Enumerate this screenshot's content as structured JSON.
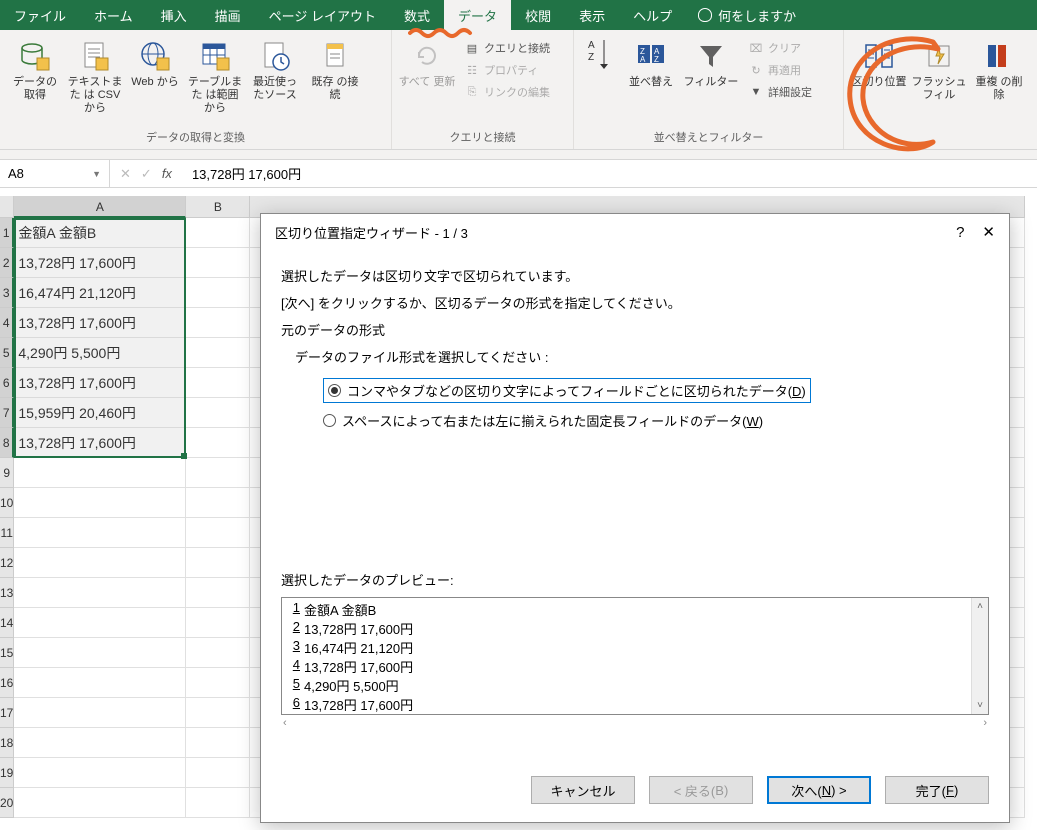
{
  "tabs": {
    "file": "ファイル",
    "home": "ホーム",
    "insert": "挿入",
    "draw": "描画",
    "pagelayout": "ページ レイアウト",
    "formulas": "数式",
    "data": "データ",
    "review": "校閲",
    "view": "表示",
    "help": "ヘルプ",
    "tellme": "何をしますか"
  },
  "ribbon": {
    "group_get": "データの取得と変換",
    "group_queries": "クエリと接続",
    "group_sort": "並べ替えとフィルター",
    "btn_getdata": "データの\n取得",
    "btn_textcsv": "テキストまた\nは CSV から",
    "btn_web": "Web\nから",
    "btn_tablerange": "テーブルまた\nは範囲から",
    "btn_recent": "最近使っ\nたソース",
    "btn_existing": "既存\nの接続",
    "btn_refresh": "すべて\n更新",
    "mini_queries": "クエリと接続",
    "mini_props": "プロパティ",
    "mini_editlinks": "リンクの編集",
    "btn_sort": "並べ替え",
    "btn_filter": "フィルター",
    "mini_clear": "クリア",
    "mini_reapply": "再適用",
    "mini_advanced": "詳細設定",
    "btn_texttocol": "区切り位置",
    "btn_flashfill": "フラッシュ\nフィル",
    "btn_removedup": "重複\nの削除"
  },
  "formula_bar": {
    "name": "A8",
    "value": "13,728円 17,600円"
  },
  "grid": {
    "col_a": "A",
    "col_b": "B",
    "rows": [
      "金額A 金額B",
      "13,728円 17,600円",
      "16,474円 21,120円",
      "13,728円 17,600円",
      "4,290円 5,500円",
      "13,728円 17,600円",
      "15,959円 20,460円",
      "13,728円 17,600円"
    ],
    "row_numbers": [
      "1",
      "2",
      "3",
      "4",
      "5",
      "6",
      "7",
      "8",
      "9",
      "10",
      "11",
      "12",
      "13",
      "14",
      "15",
      "16",
      "17",
      "18",
      "19",
      "20"
    ]
  },
  "dialog": {
    "title": "区切り位置指定ウィザード - 1 / 3",
    "line1": "選択したデータは区切り文字で区切られています。",
    "line2": "[次へ] をクリックするか、区切るデータの形式を指定してください。",
    "section_format": "元のデータの形式",
    "prompt_filetype": "データのファイル形式を選択してください :",
    "opt_delimited_pre": "コンマやタブなどの区切り文字によってフィールドごとに区切られたデータ(",
    "opt_delimited_hot": "D",
    "opt_fixed_pre": "スペースによって右または左に揃えられた固定長フィールドのデータ(",
    "opt_fixed_hot": "W",
    "close_paren": ")",
    "preview_label": "選択したデータのプレビュー:",
    "preview_lines": [
      {
        "n": "1",
        "t": "金額A 金額B"
      },
      {
        "n": "2",
        "t": "13,728円 17,600円"
      },
      {
        "n": "3",
        "t": "16,474円 21,120円"
      },
      {
        "n": "4",
        "t": "13,728円 17,600円"
      },
      {
        "n": "5",
        "t": "4,290円 5,500円"
      },
      {
        "n": "6",
        "t": "13,728円 17,600円"
      }
    ],
    "btn_cancel": "キャンセル",
    "btn_back_pre": "< 戻る(",
    "btn_back_hot": "B",
    "btn_next_pre": "次へ(",
    "btn_next_hot": "N",
    "btn_next_post": ") >",
    "btn_finish_pre": "完了(",
    "btn_finish_hot": "F"
  }
}
